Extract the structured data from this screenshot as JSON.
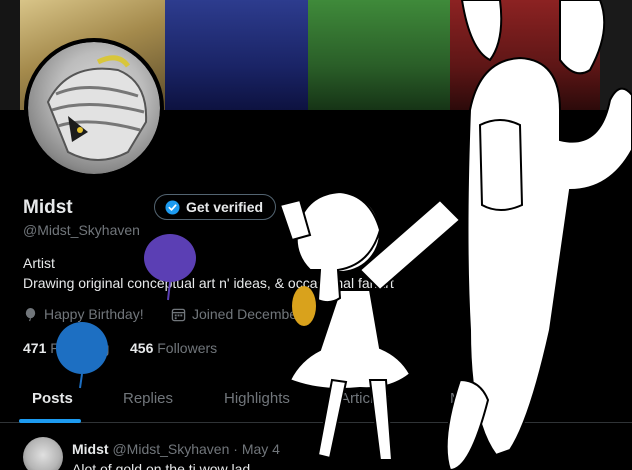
{
  "profile": {
    "name": "Midst",
    "verify_label": "Get verified",
    "handle": "@Midst_Skyhaven",
    "bio_title": "Artist",
    "bio_text": "Drawing original conceptual art n' ideas, & occasional fanart",
    "birthday": "Happy Birthday!",
    "joined": "Joined December",
    "following_count": "471",
    "following_label": "Following",
    "followers_count": "456",
    "followers_label": "Followers"
  },
  "tabs": [
    {
      "label": "Posts"
    },
    {
      "label": "Replies"
    },
    {
      "label": "Highlights"
    },
    {
      "label": "Articles"
    },
    {
      "label": "Media"
    }
  ],
  "post": {
    "author": "Midst",
    "meta": "@Midst_Skyhaven · May 4",
    "text": "Alot of gold on the ti wow lad"
  },
  "colors": {
    "accent": "#1d9bf0",
    "balloon_purple": "#5b3fb4",
    "balloon_blue": "#1d6fc2",
    "balloon_yellow": "#d9a21c"
  },
  "icons": [
    "verified-badge-icon",
    "balloon-icon",
    "calendar-icon"
  ]
}
